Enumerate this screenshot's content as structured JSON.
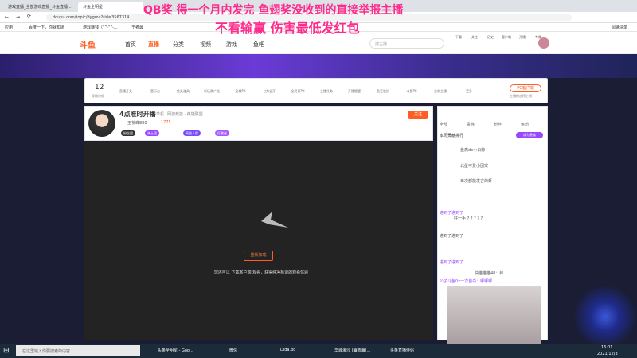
{
  "browser": {
    "tabs": [
      "游戏直播_全部游戏直播_斗鱼直播...",
      "斗鱼全明星"
    ],
    "url": "douyu.com/topic/dygmx?rid=3567314",
    "bookmarks": [
      "应用",
      "百度一下，你就知道",
      "游戏赚钱（“”-“”-...",
      "王者最"
    ],
    "bookmark_right": "阅读清单"
  },
  "overlay": {
    "line1": "QB奖  得一个月内发完  鱼翅奖没收到的直接举报主播",
    "line2": "不看输赢 伤害最低发红包"
  },
  "header": {
    "logo": "斗鱼",
    "nav": [
      "首页",
      "直播",
      "分类",
      "视频",
      "游戏",
      "鱼吧"
    ],
    "search_placeholder": "搜主播",
    "icons": [
      {
        "label": "下载",
        "icon": "download-icon"
      },
      {
        "label": "关注",
        "icon": "heart-icon"
      },
      {
        "label": "历史",
        "icon": "history-icon"
      },
      {
        "label": "客户端",
        "icon": "client-icon"
      },
      {
        "label": "开播",
        "icon": "broadcast-icon"
      },
      {
        "label": "专属",
        "icon": "crown-icon"
      }
    ]
  },
  "toolbar": {
    "level_num": "12",
    "level_label": "等级特权",
    "items": [
      "直播开关",
      "音乐台",
      "鱼丸道具",
      "新玩偶广告",
      "全城PK",
      "七力全开",
      "全民开PK",
      "主播任务",
      "开播提醒",
      "鱼豆装扮",
      "斗鱼PK",
      "全新主播",
      "更多"
    ],
    "pc_btn": "PC客户端",
    "pc_sub": "主播粉丝榜上线"
  },
  "room": {
    "title": "4点准时开播",
    "category": "单机",
    "sub": "网游竞技 · 英雄联盟",
    "streamer": "王祈峰880",
    "stats": "1775",
    "tags": [
      "粉丝团",
      "骑士团",
      "高能人群",
      "打赏送",
      "钻石会员"
    ],
    "follow": "关注"
  },
  "player": {
    "reload": "重新加载",
    "hint": "您还可以 下载客户端 观看，获得纯净极速的观看体验"
  },
  "chat": {
    "tabs": [
      "全部",
      "贵族",
      "粉丝",
      "鱼粉"
    ],
    "header": "本周贡献排行",
    "rank_btn": "成为贵族",
    "rows": [
      "鱼痛de小白鲸",
      "北星可爱小团宠",
      "每次都能发言的虾"
    ],
    "messages": [
      "进到了进到了",
      "好一手 ? ? ? ? ?",
      "进到了进到了",
      "进到了进到了",
      "快猫猫猫48：帅",
      "公子斗鱼0x一次自白：哪哪哪"
    ]
  },
  "taskbar": {
    "search": "在这里输入你要搜索的内容",
    "items": [
      "头条全明星 - Goo...",
      "微信",
      "Dida.bq",
      "华城海沙 (幽蓝海)...",
      "头条直播伴侣"
    ],
    "time": "16:01",
    "date": "2021/12/3"
  },
  "colors": {
    "accent": "#ff5d23",
    "overlay": "#ff2a8a"
  }
}
